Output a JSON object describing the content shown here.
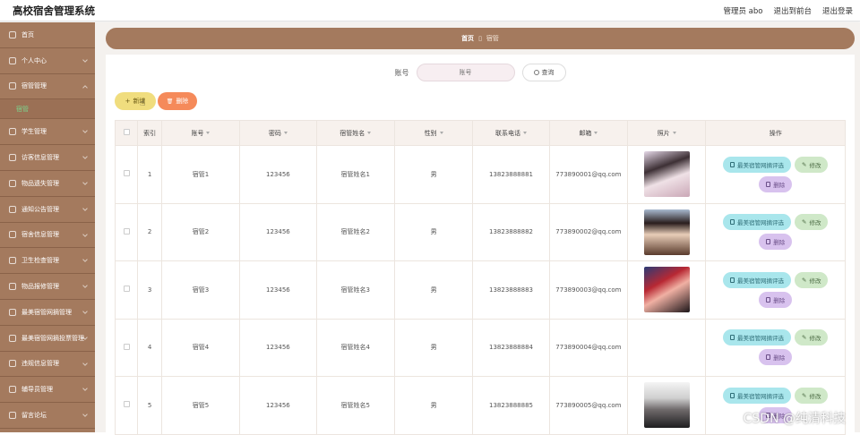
{
  "app": {
    "title": "高校宿舍管理系统"
  },
  "topbar": {
    "admin": "管理员 abo",
    "back_front": "退出到前台",
    "logout": "退出登录"
  },
  "sidebar": {
    "items": [
      {
        "label": "首页"
      },
      {
        "label": "个人中心"
      },
      {
        "label": "宿管管理",
        "sub": "宿管"
      },
      {
        "label": "学生管理"
      },
      {
        "label": "访客信息管理"
      },
      {
        "label": "物品遗失管理"
      },
      {
        "label": "通知公告管理"
      },
      {
        "label": "宿舍信息管理"
      },
      {
        "label": "卫生检查管理"
      },
      {
        "label": "物品报修管理"
      },
      {
        "label": "最美宿管网摘管理"
      },
      {
        "label": "最美宿管网摘投票管理"
      },
      {
        "label": "违规信息管理"
      },
      {
        "label": "辅导员管理"
      },
      {
        "label": "留言论坛"
      }
    ]
  },
  "breadcrumb": {
    "home": "首页",
    "sep": "▯",
    "current": "宿管"
  },
  "search": {
    "label": "账号",
    "placeholder": "账号",
    "button": "查询"
  },
  "actions": {
    "add": "新增",
    "delete": "删除",
    "add_icon": "+",
    "del_icon": "🗑"
  },
  "table": {
    "headers": [
      "索引",
      "账号",
      "密码",
      "宿管姓名",
      "性别",
      "联系电话",
      "邮箱",
      "照片",
      "操作"
    ],
    "rows": [
      {
        "index": "1",
        "account": "宿管1",
        "password": "123456",
        "name": "宿管姓名1",
        "gender": "男",
        "phone": "13823888881",
        "email": "773890001@qq.com"
      },
      {
        "index": "2",
        "account": "宿管2",
        "password": "123456",
        "name": "宿管姓名2",
        "gender": "男",
        "phone": "13823888882",
        "email": "773890002@qq.com"
      },
      {
        "index": "3",
        "account": "宿管3",
        "password": "123456",
        "name": "宿管姓名3",
        "gender": "男",
        "phone": "13823888883",
        "email": "773890003@qq.com"
      },
      {
        "index": "4",
        "account": "宿管4",
        "password": "123456",
        "name": "宿管姓名4",
        "gender": "男",
        "phone": "13823888884",
        "email": "773890004@qq.com"
      },
      {
        "index": "5",
        "account": "宿管5",
        "password": "123456",
        "name": "宿管姓名5",
        "gender": "男",
        "phone": "13823888885",
        "email": "773890005@qq.com"
      }
    ],
    "ops": {
      "eval": "最美宿管网摘评选",
      "edit": "修改",
      "del": "删除"
    }
  },
  "watermark": "CSDN @纯清科技"
}
